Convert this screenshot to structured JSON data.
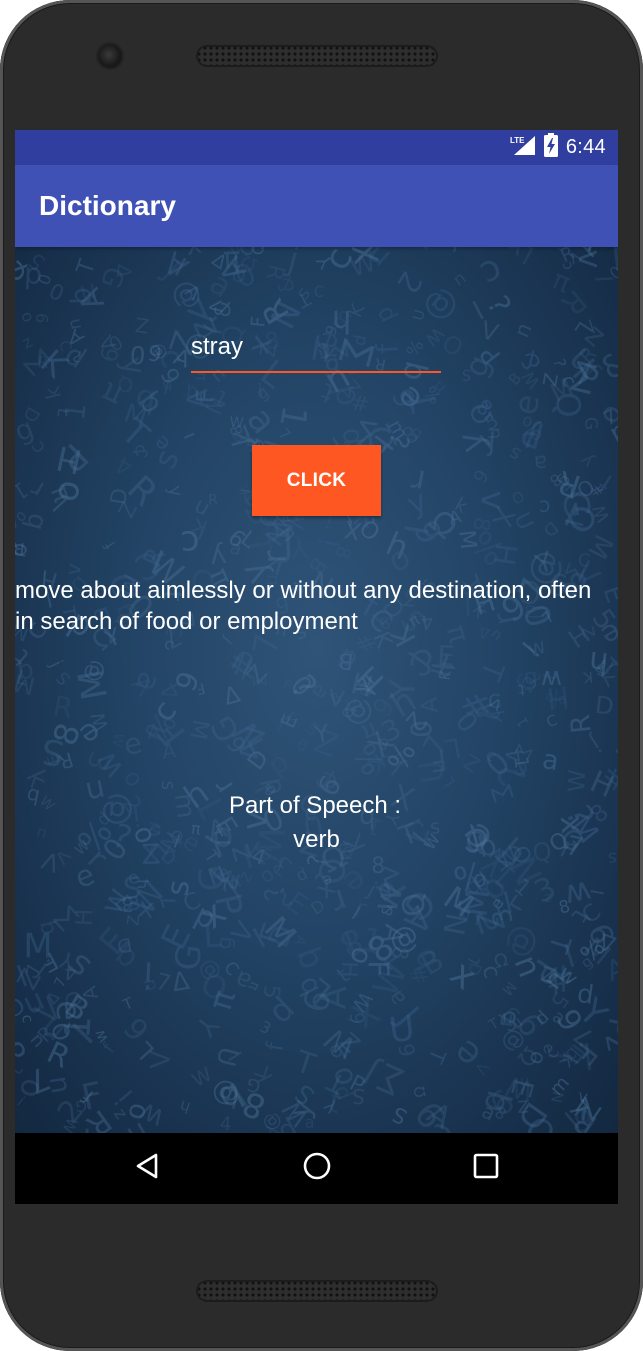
{
  "status_bar": {
    "network": "LTE",
    "time": "6:44"
  },
  "app_bar": {
    "title": "Dictionary"
  },
  "search": {
    "value": "stray"
  },
  "button": {
    "label": "CLICK"
  },
  "result": {
    "definition": "move about aimlessly or without any destination, often in search of food or employment",
    "part_of_speech_label": "Part of Speech :",
    "part_of_speech_value": "verb"
  },
  "nav_bar": {
    "icons": [
      "back-icon",
      "home-icon",
      "recents-icon"
    ]
  },
  "colors": {
    "status_bar": "#303f9f",
    "app_bar": "#3f51b5",
    "accent": "#ff5722",
    "background": "#224364"
  }
}
